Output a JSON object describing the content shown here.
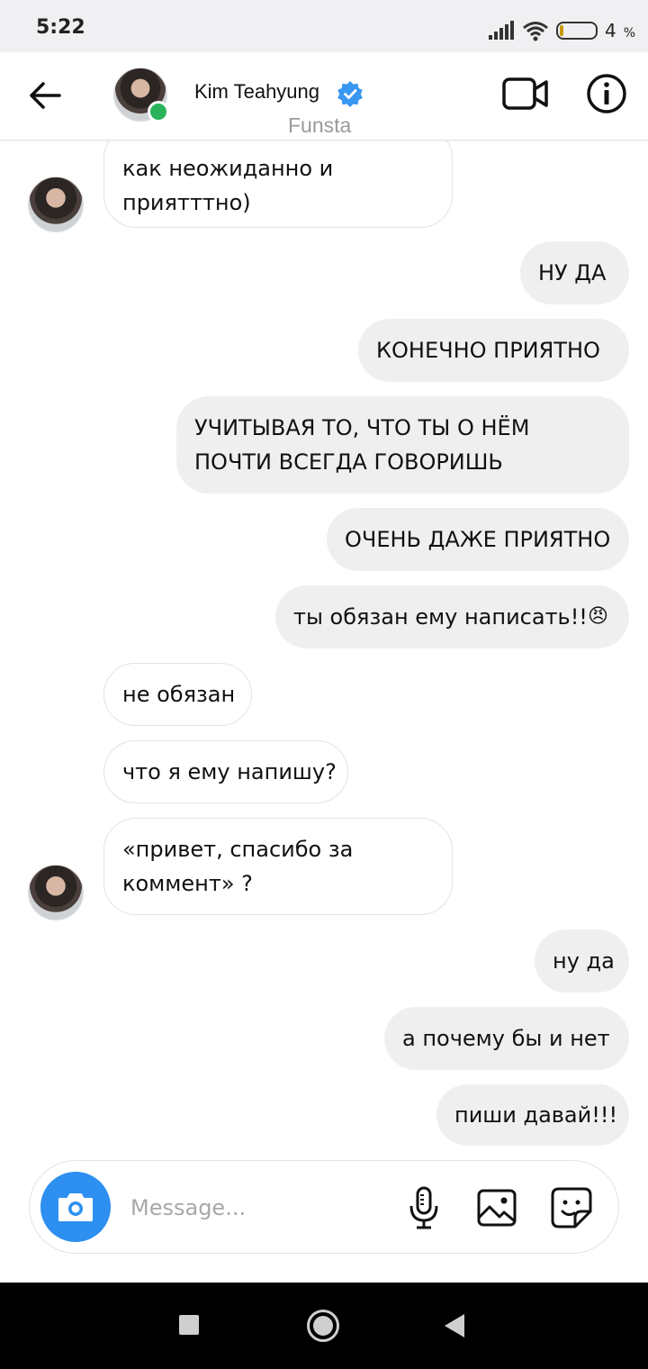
{
  "status_bar": {
    "time": "5:22",
    "battery": "4",
    "battery_unit": "%",
    "icons": [
      "signal-icon",
      "wifi-icon",
      "battery-icon"
    ]
  },
  "header": {
    "name": "Kim Teahyung",
    "subtitle": "Funsta",
    "verified": true,
    "online": true,
    "icons": [
      "back-arrow-icon",
      "verified-badge-icon",
      "video-call-icon",
      "info-icon"
    ]
  },
  "messages": [
    {
      "side": "in",
      "lines": [
        "как неожиданно и",
        "приятттно)"
      ]
    },
    {
      "side": "out",
      "lines": [
        "НУ ДА"
      ]
    },
    {
      "side": "out",
      "lines": [
        "КОНЕЧНО ПРИЯТНО"
      ]
    },
    {
      "side": "out",
      "lines": [
        "УЧИТЫВАЯ ТО, ЧТО ТЫ О НЁМ",
        "ПОЧТИ ВСЕГДА ГОВОРИШЬ"
      ]
    },
    {
      "side": "out",
      "lines": [
        "ОЧЕНЬ ДАЖЕ ПРИЯТНО"
      ]
    },
    {
      "side": "out",
      "lines": [
        "ты обязан ему написать!!"
      ],
      "emoji": "😠"
    },
    {
      "side": "in",
      "lines": [
        "не обязан"
      ]
    },
    {
      "side": "in",
      "lines": [
        "что я ему напишу?"
      ]
    },
    {
      "side": "in",
      "lines": [
        "«привет, спасибо за",
        "коммент» ?"
      ]
    },
    {
      "side": "out",
      "lines": [
        "ну да"
      ]
    },
    {
      "side": "out",
      "lines": [
        "а почему бы и нет"
      ]
    },
    {
      "side": "out",
      "lines": [
        "пиши давай!!!"
      ]
    }
  ],
  "composer": {
    "placeholder": "Message...",
    "value": "",
    "icons": [
      "camera-icon",
      "microphone-icon",
      "gallery-icon",
      "sticker-icon"
    ]
  },
  "colors": {
    "accent": "#2d8ff0",
    "verified": "#3897f0",
    "online": "#29b35a",
    "outgoing_bubble": "#efefef",
    "status_bar": "#f0f0f2"
  }
}
